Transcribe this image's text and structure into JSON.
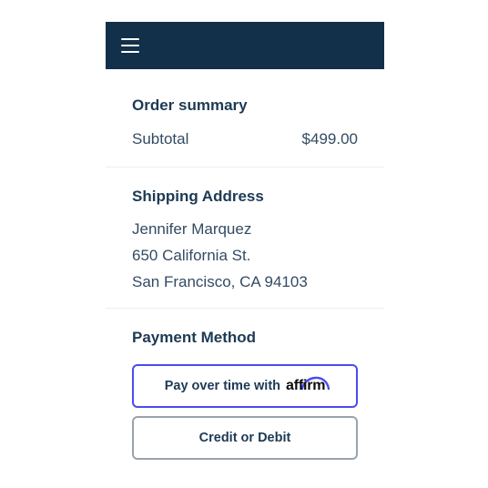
{
  "header": {
    "menu_icon": "hamburger-menu-icon",
    "background": "#12304a"
  },
  "order_summary": {
    "title": "Order summary",
    "subtotal_label": "Subtotal",
    "subtotal_value": "$499.00"
  },
  "shipping": {
    "title": "Shipping Address",
    "name": "Jennifer Marquez",
    "street": "650 California St.",
    "city_line": "San Francisco, CA 94103"
  },
  "payment": {
    "title": "Payment Method",
    "affirm_button_label": "Pay over time with",
    "affirm_logo_text": "affirm",
    "card_button_label": "Credit or Debit",
    "affirm_accent": "#4a4af4"
  }
}
